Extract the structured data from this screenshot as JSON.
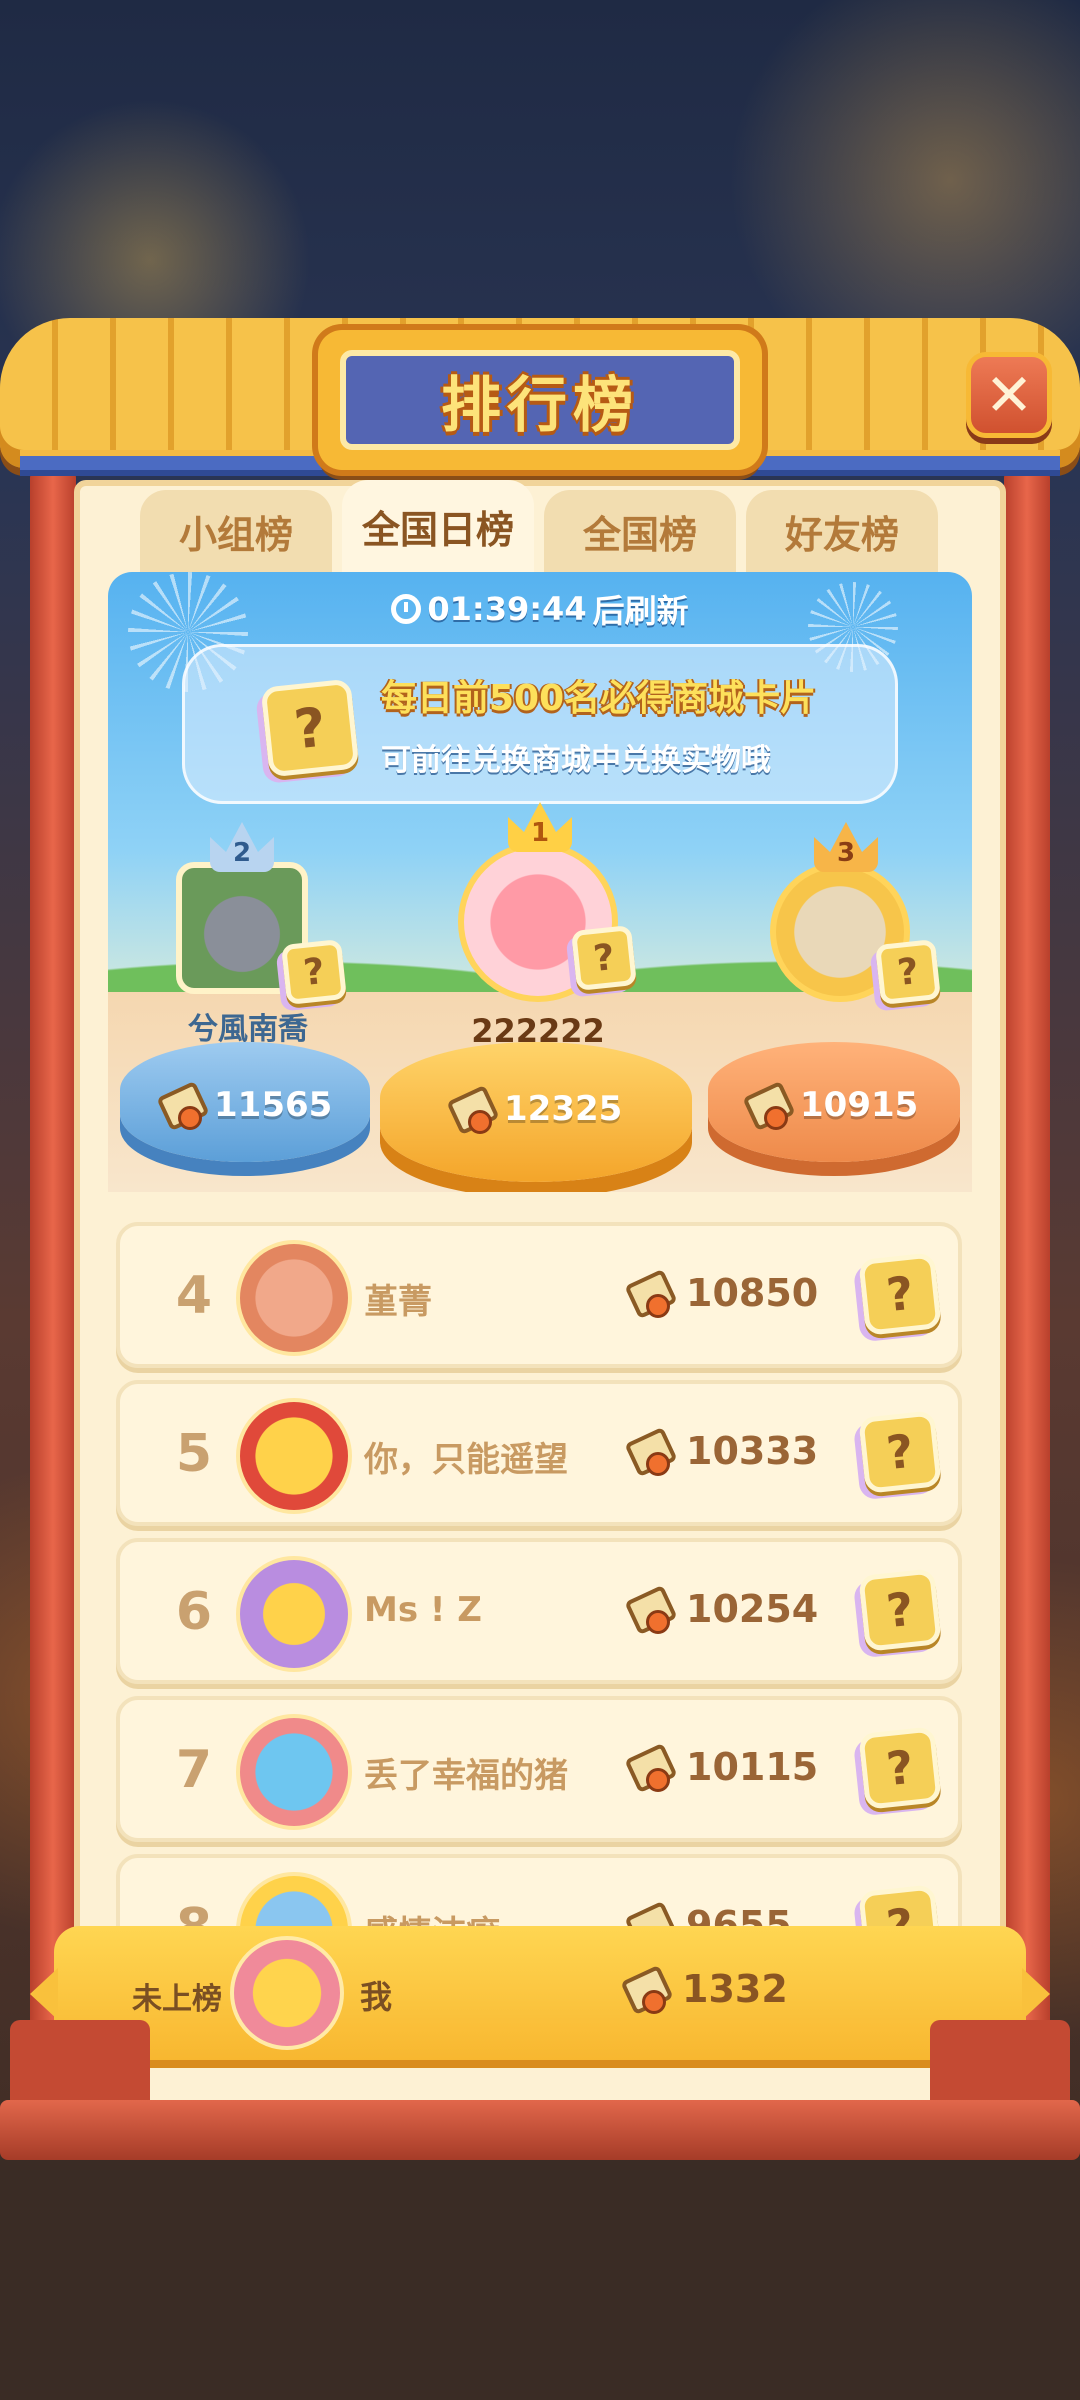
{
  "title": "排行榜",
  "close_label": "✕",
  "tabs": [
    {
      "label": "小组榜",
      "active": false
    },
    {
      "label": "全国日榜",
      "active": true
    },
    {
      "label": "全国榜",
      "active": false
    },
    {
      "label": "好友榜",
      "active": false
    }
  ],
  "timer": {
    "countdown": "01:39:44",
    "suffix": "后刷新"
  },
  "notice": {
    "line1": "每日前500名必得商城卡片",
    "line2": "可前往兑换商城中兑换实物哦",
    "card_mark": "?"
  },
  "podium": [
    {
      "rank": "2",
      "name": "兮風南喬",
      "score": "11565"
    },
    {
      "rank": "1",
      "name": "222222",
      "score": "12325"
    },
    {
      "rank": "3",
      "name": "",
      "score": "10915"
    }
  ],
  "list": [
    {
      "rank": "4",
      "name": "堇菁",
      "score": "10850",
      "avatar_color": "#f1a88a"
    },
    {
      "rank": "5",
      "name": "你，只能遥望",
      "score": "10333",
      "avatar_color": "#ffd24a"
    },
    {
      "rank": "6",
      "name": "Ms ! Z",
      "score": "10254",
      "avatar_color": "#b98de0"
    },
    {
      "rank": "7",
      "name": "丢了幸福的猪",
      "score": "10115",
      "avatar_color": "#6ec6f0"
    },
    {
      "rank": "8",
      "name": "感情洁癖",
      "score": "9655",
      "avatar_color": "#8ac6f0"
    }
  ],
  "me": {
    "rank_text": "未上榜",
    "name": "我",
    "score": "1332"
  },
  "colors": {
    "accent": "#f7b935",
    "panel": "#fdf1d4",
    "text_brown": "#9a6536",
    "close_red": "#d0512f"
  },
  "icons": {
    "score": "coupon-icon",
    "card": "card-question-icon",
    "clock": "clock-icon",
    "close": "close-icon"
  }
}
